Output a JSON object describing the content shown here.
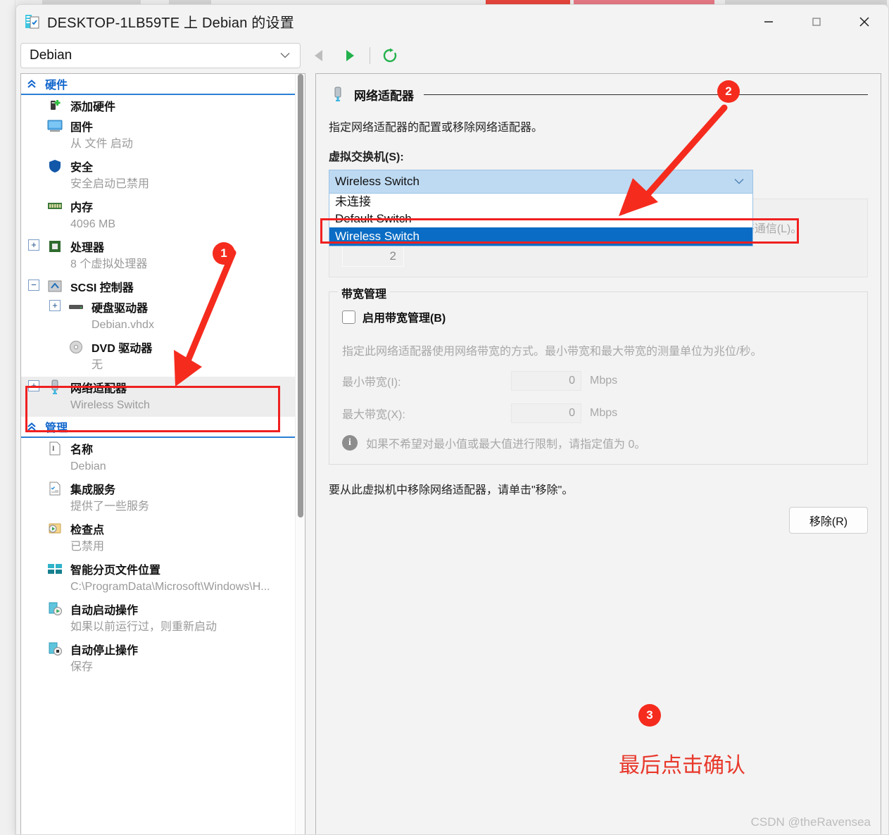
{
  "window": {
    "title": "DESKTOP-1LB59TE 上 Debian 的设置",
    "icon": "settings-vm-icon",
    "minimize_label": "—",
    "maximize_label": "□",
    "close_label": "✕"
  },
  "toolbar": {
    "vm_selected": "Debian",
    "back_icon": "back-triangle-icon",
    "forward_icon": "forward-triangle-icon",
    "refresh_icon": "refresh-icon"
  },
  "tree": {
    "sections": [
      {
        "title": "硬件",
        "items": [
          {
            "label": "添加硬件",
            "sub": "",
            "icon": "add-hardware-icon",
            "expander": ""
          },
          {
            "label": "固件",
            "sub": "从 文件 启动",
            "icon": "firmware-monitor-icon",
            "expander": ""
          },
          {
            "label": "安全",
            "sub": "安全启动已禁用",
            "icon": "security-shield-icon",
            "expander": ""
          },
          {
            "label": "内存",
            "sub": "4096 MB",
            "icon": "memory-icon",
            "expander": "+"
          },
          {
            "label": "处理器",
            "sub": "8 个虚拟处理器",
            "icon": "processor-icon",
            "expander": "+"
          },
          {
            "label": "SCSI 控制器",
            "sub": "",
            "icon": "scsi-controller-icon",
            "expander": "−"
          },
          {
            "label": "硬盘驱动器",
            "sub": "Debian.vhdx",
            "icon": "hard-drive-icon",
            "expander": "+"
          },
          {
            "label": "DVD 驱动器",
            "sub": "无",
            "icon": "dvd-drive-icon",
            "expander": ""
          },
          {
            "label": "网络适配器",
            "sub": "Wireless Switch",
            "icon": "network-adapter-icon",
            "expander": "+"
          }
        ]
      },
      {
        "title": "管理",
        "items": [
          {
            "label": "名称",
            "sub": "Debian",
            "icon": "name-tag-icon",
            "expander": ""
          },
          {
            "label": "集成服务",
            "sub": "提供了一些服务",
            "icon": "integration-services-icon",
            "expander": ""
          },
          {
            "label": "检查点",
            "sub": "已禁用",
            "icon": "checkpoint-icon",
            "expander": ""
          },
          {
            "label": "智能分页文件位置",
            "sub": "C:\\ProgramData\\Microsoft\\Windows\\H...",
            "icon": "smart-paging-icon",
            "expander": ""
          },
          {
            "label": "自动启动操作",
            "sub": "如果以前运行过，则重新启动",
            "icon": "automatic-start-icon",
            "expander": ""
          },
          {
            "label": "自动停止操作",
            "sub": "保存",
            "icon": "automatic-stop-icon",
            "expander": ""
          }
        ]
      }
    ]
  },
  "panel": {
    "icon": "network-adapter-icon",
    "title": "网络适配器",
    "description": "指定网络适配器的配置或移除网络适配器。",
    "switch_label": "虚拟交换机(S):",
    "switch_selected": "Wireless Switch",
    "switch_options": [
      "未连接",
      "Default Switch",
      "Wireless Switch"
    ],
    "vlan": {
      "description": "VLAN 标识符指定虚拟 LAN，该虚拟机将此 LAN 用于通过此网络适配器的所有网络通信(L)。",
      "value": "2"
    },
    "bandwidth": {
      "group_title": "带宽管理",
      "enable_label": "启用带宽管理(B)",
      "enable_checked": false,
      "description": "指定此网络适配器使用网络带宽的方式。最小带宽和最大带宽的测量单位为兆位/秒。",
      "min_label": "最小带宽(I):",
      "min_value": "0",
      "max_label": "最大带宽(X):",
      "max_value": "0",
      "unit": "Mbps",
      "info_icon": "info-icon",
      "info_text": "如果不希望对最小值或最大值进行限制，请指定值为 0。"
    },
    "remove_description": "要从此虚拟机中移除网络适配器，请单击\"移除\"。",
    "remove_button": "移除(R)"
  },
  "annotations": {
    "badge1": "1",
    "badge2": "2",
    "badge3": "3",
    "note": "最后点击确认",
    "watermark": "CSDN @theRavensea",
    "accent_color": "#f52b1e"
  }
}
